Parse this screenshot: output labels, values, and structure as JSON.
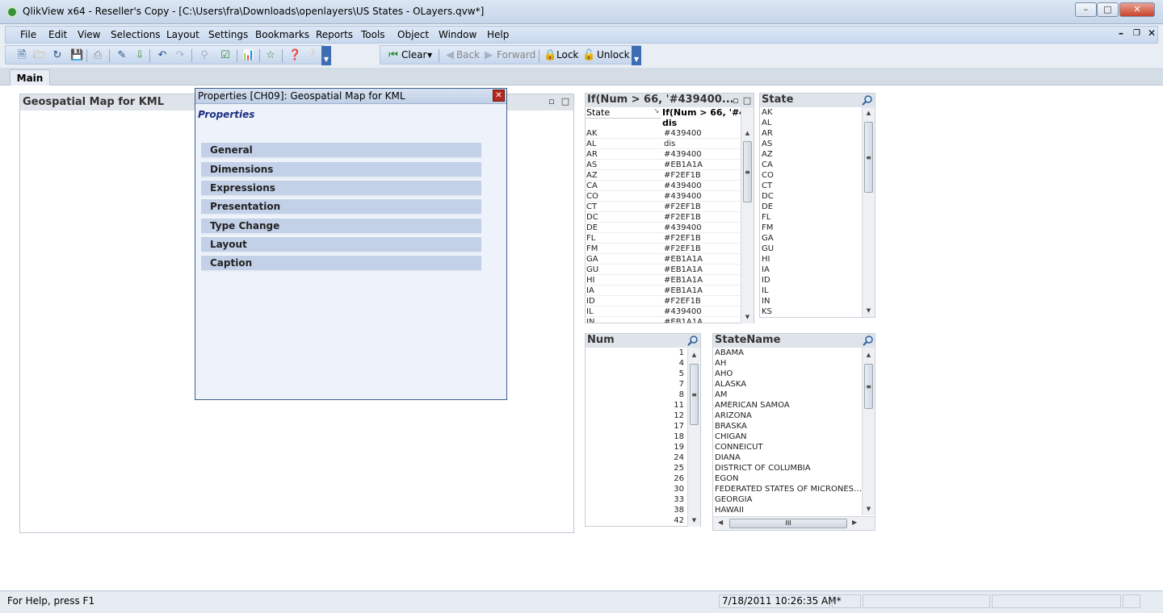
{
  "window": {
    "title": "QlikView x64 - Reseller's Copy - [C:\\Users\\fra\\Downloads\\openlayers\\US States - OLayers.qvw*]",
    "controls": {
      "minimize": "–",
      "maximize": "□",
      "close": "✕"
    }
  },
  "menu": [
    "File",
    "Edit",
    "View",
    "Selections",
    "Layout",
    "Settings",
    "Bookmarks",
    "Reports",
    "Tools",
    "Object",
    "Window",
    "Help"
  ],
  "toolbar": {
    "clear": "Clear",
    "back": "Back",
    "forward": "Forward",
    "lock": "Lock",
    "unlock": "Unlock"
  },
  "tabs": [
    "Main"
  ],
  "map_object": {
    "title": "Geospatial Map for KML"
  },
  "properties_dialog": {
    "title": "Properties [CH09]: Geospatial Map for KML",
    "heading": "Properties",
    "sections": [
      "General",
      "Dimensions",
      "Expressions",
      "Presentation",
      "Type Change",
      "Layout",
      "Caption"
    ]
  },
  "color_table": {
    "title": "If(Num > 66, '#439400...",
    "col1_header": "State",
    "col2_header": "If(Num > 66, '#43",
    "col2_subheader": "dis",
    "rows": [
      [
        "AK",
        "#439400"
      ],
      [
        "AL",
        "dis"
      ],
      [
        "AR",
        "#439400"
      ],
      [
        "AS",
        "#EB1A1A"
      ],
      [
        "AZ",
        "#F2EF1B"
      ],
      [
        "CA",
        "#439400"
      ],
      [
        "CO",
        "#439400"
      ],
      [
        "CT",
        "#F2EF1B"
      ],
      [
        "DC",
        "#F2EF1B"
      ],
      [
        "DE",
        "#439400"
      ],
      [
        "FL",
        "#F2EF1B"
      ],
      [
        "FM",
        "#F2EF1B"
      ],
      [
        "GA",
        "#EB1A1A"
      ],
      [
        "GU",
        "#EB1A1A"
      ],
      [
        "HI",
        "#EB1A1A"
      ],
      [
        "IA",
        "#EB1A1A"
      ],
      [
        "ID",
        "#F2EF1B"
      ],
      [
        "IL",
        "#439400"
      ],
      [
        "IN",
        "#EB1A1A"
      ]
    ]
  },
  "state_list": {
    "title": "State",
    "items": [
      "AK",
      "AL",
      "AR",
      "AS",
      "AZ",
      "CA",
      "CO",
      "CT",
      "DC",
      "DE",
      "FL",
      "FM",
      "GA",
      "GU",
      "HI",
      "IA",
      "ID",
      "IL",
      "IN",
      "KS"
    ]
  },
  "num_list": {
    "title": "Num",
    "items": [
      "1",
      "4",
      "5",
      "7",
      "8",
      "11",
      "12",
      "17",
      "18",
      "19",
      "24",
      "25",
      "26",
      "30",
      "33",
      "38",
      "42"
    ]
  },
  "statename_list": {
    "title": "StateName",
    "items": [
      "ABAMA",
      "AH",
      "AHO",
      "ALASKA",
      "AM",
      "AMERICAN SAMOA",
      "ARIZONA",
      "BRASKA",
      "CHIGAN",
      "CONNEICUT",
      "DIANA",
      "DISTRICT OF COLUMBIA",
      "EGON",
      "FEDERATED STATES OF MICRONES…",
      "GEORGIA",
      "HAWAII"
    ]
  },
  "status": {
    "help": "For Help, press F1",
    "timestamp": "7/18/2011 10:26:35 AM*"
  }
}
